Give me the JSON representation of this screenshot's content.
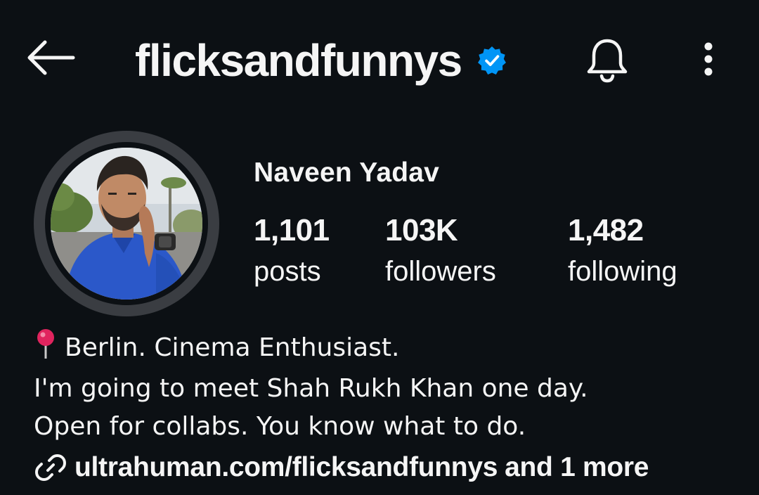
{
  "header": {
    "back_icon": "arrow-left-icon",
    "username": "flicksandfunnys",
    "verified_icon": "verified-badge-icon",
    "verified_color": "#0095f6",
    "notifications_icon": "bell-icon",
    "more_icon": "more-vertical-icon"
  },
  "profile": {
    "full_name": "Naveen Yadav",
    "avatar": "profile-photo"
  },
  "stats": [
    {
      "count": "1,101",
      "label": "posts"
    },
    {
      "count": "103K",
      "label": "followers"
    },
    {
      "count": "1,482",
      "label": "following"
    }
  ],
  "bio": {
    "pin_icon": "📍",
    "line1": "Berlin. Cinema Enthusiast.",
    "line2": "I'm going to meet Shah Rukh Khan one day.",
    "line3": "Open for collabs. You know what to do."
  },
  "link": {
    "icon": "link-icon",
    "url": "ultrahuman.com/flicksandfunnys",
    "more": "and 1 more"
  },
  "colors": {
    "background": "#0c1014",
    "text": "#f5f5f5",
    "avatar_ring": "#3a3d42"
  }
}
